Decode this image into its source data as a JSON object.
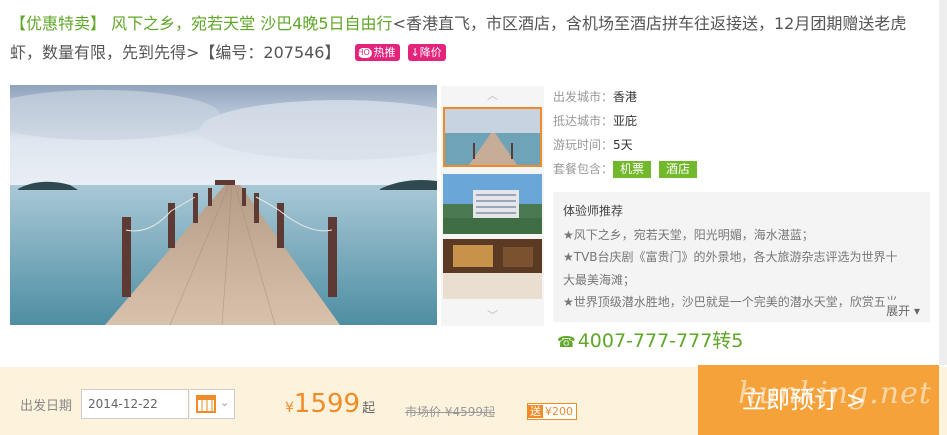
{
  "title": {
    "tag": "【优惠特卖】",
    "green": "风下之乡，宛若天堂 沙巴4晚5日自由行",
    "rest": "<香港直飞，市区酒店，含机场至酒店拼车往返接送，12月团期赠送老虎虾，数量有限，先到先得>【编号：207546】",
    "hot_icon": "HOT",
    "hot": "热推",
    "down_icon": "↓",
    "down": "降价"
  },
  "gallery": {
    "up_arrow": "︿",
    "down_arrow": "﹀"
  },
  "info": {
    "depart_label": "出发城市：",
    "depart_value": "香港",
    "arrive_label": "抵达城市：",
    "arrive_value": "亚庇",
    "duration_label": "游玩时间：",
    "duration_value": "5天",
    "package_label": "套餐包含：",
    "package_items": [
      "机票",
      "酒店"
    ]
  },
  "recommend": {
    "head": "体验师推荐",
    "lines": [
      "★风下之乡，宛若天堂，阳光明媚，海水湛蓝；",
      "★TVB台庆剧《富贵门》的外景地，各大旅游杂志评选为世界十",
      "大最美海滩；",
      "★世界顶级潜水胜地，沙巴就是一个完美的潜水天堂，欣赏五光"
    ],
    "more": "展开 ▾"
  },
  "phone": {
    "icon": "☎",
    "number": "4007-777-777转5"
  },
  "bar": {
    "date_label": "出发日期",
    "date_value": "2014-12-22",
    "caret": "⌄",
    "currency": "¥",
    "price": "1599",
    "price_suffix": "起",
    "market_price": "市场价 ¥4599起",
    "gift_label": "送",
    "gift_value": "¥200",
    "book_label": "立即预订 >",
    "watermark": "hunking.net"
  },
  "colors": {
    "green": "#5fa727",
    "orange": "#f08c28",
    "book": "#f6a23b",
    "pink": "#e3247a"
  }
}
